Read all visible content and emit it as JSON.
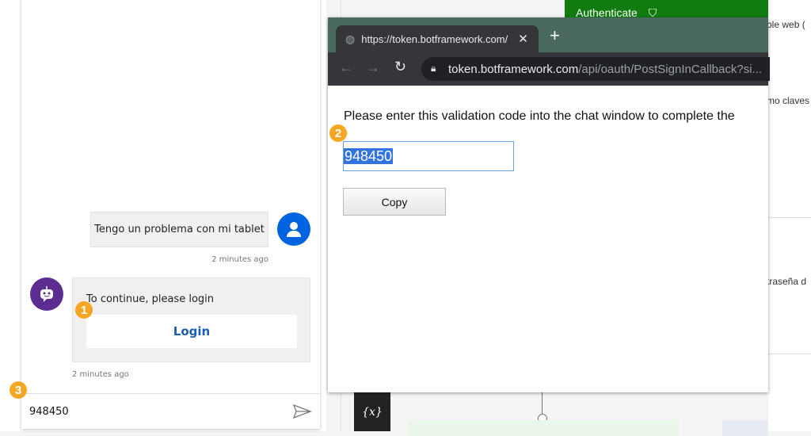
{
  "chat": {
    "user_message": "Tengo un problema con mi tablet",
    "user_timestamp": "2 minutes ago",
    "bot_message": "To continue, please login",
    "login_button": "Login",
    "bot_timestamp": "2 minutes ago",
    "input_value": "948450"
  },
  "badges": [
    "1",
    "2",
    "3"
  ],
  "browser": {
    "tab_title": "https://token.botframework.com/",
    "url_host": "token.botframework.com",
    "url_path": "/api/oauth/PostSignInCallback?si...",
    "message": "Please enter this validation code into the chat window to complete the",
    "code": "948450",
    "copy_button": "Copy"
  },
  "canvas": {
    "authenticate_node": "Authenticate",
    "variable_icon": "{x}"
  },
  "right_panel": {
    "snippets": [
      "ble web (",
      "mo claves",
      "traseña d"
    ]
  },
  "colors": {
    "user_avatar": "#0063e0",
    "bot_avatar": "#5c2d91",
    "badge": "#f5a623",
    "login": "#1a5fb4",
    "auth_node": "#107c10"
  }
}
